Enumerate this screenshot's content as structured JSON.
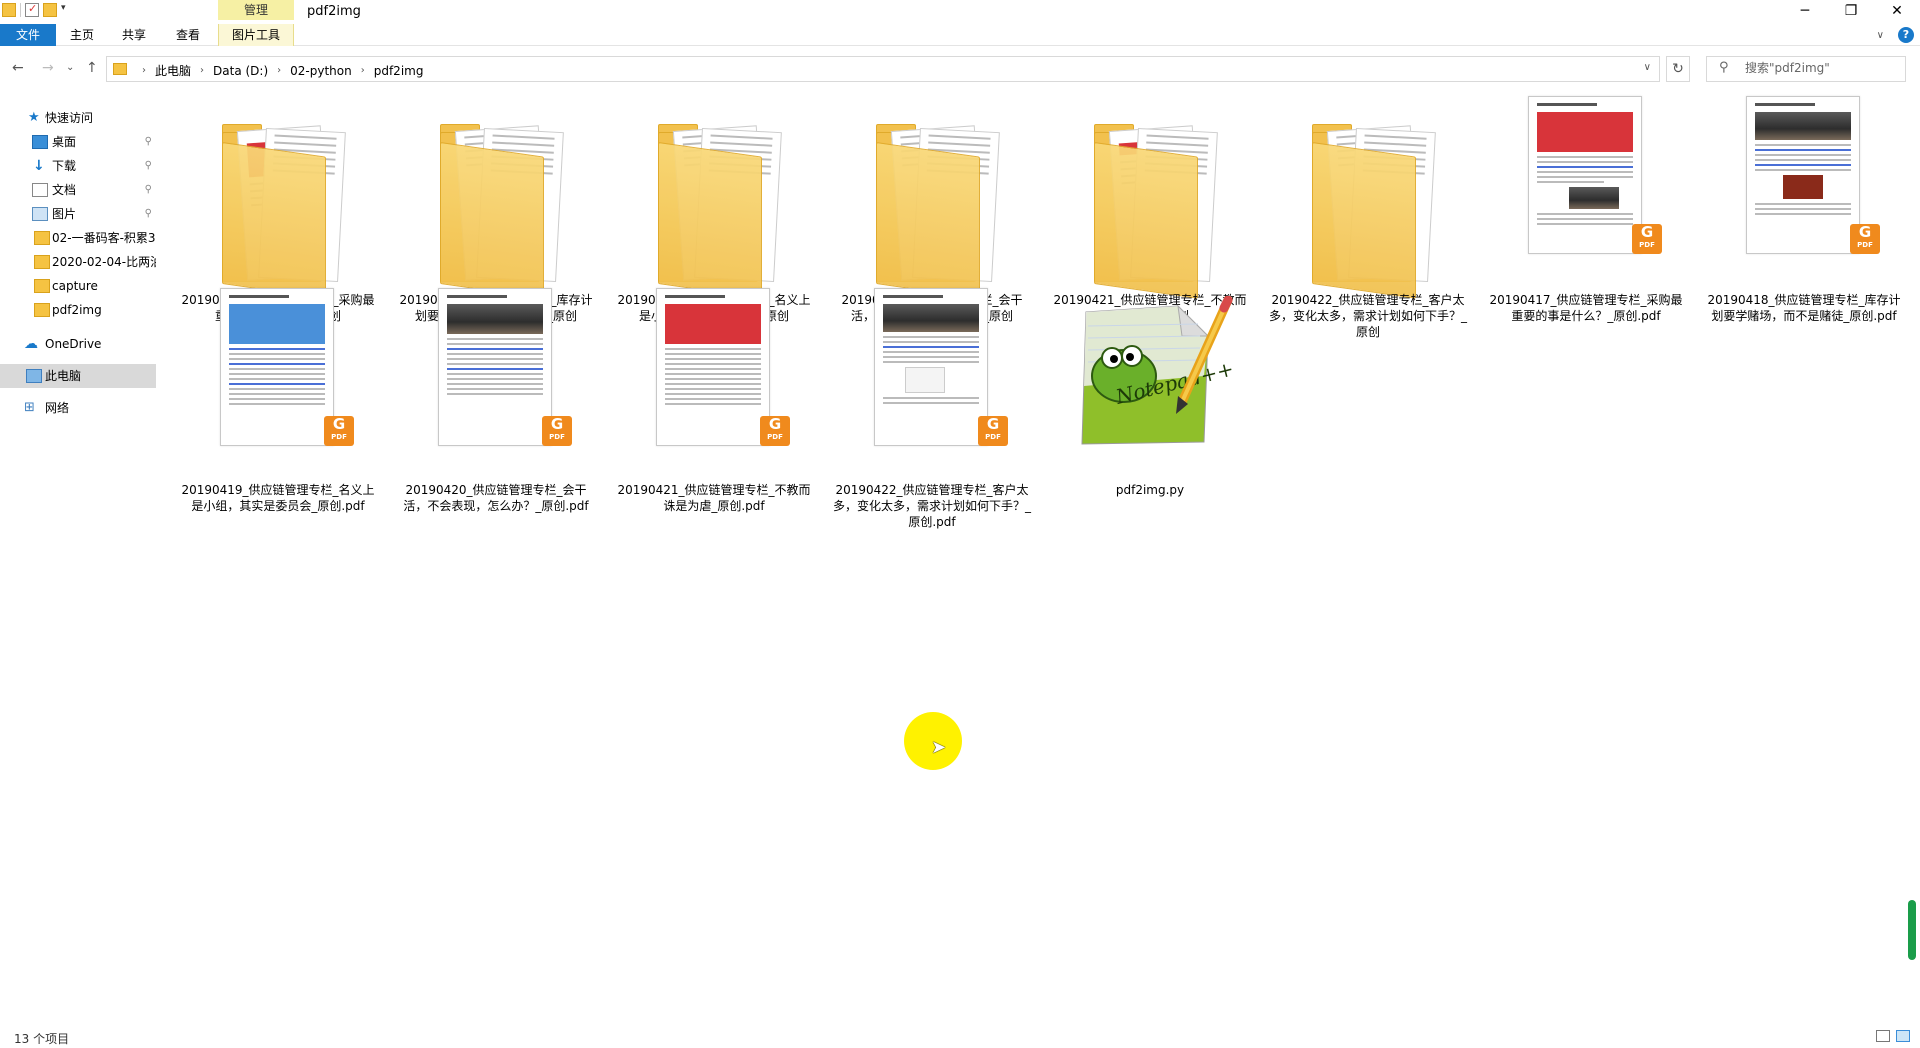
{
  "window": {
    "title": "pdf2img",
    "context_tab": "管理",
    "controls": {
      "minimize": "─",
      "maximize": "❐",
      "close": "✕"
    }
  },
  "ribbon": {
    "tabs": [
      {
        "label": "文件"
      },
      {
        "label": "主页"
      },
      {
        "label": "共享"
      },
      {
        "label": "查看"
      },
      {
        "label": "图片工具"
      }
    ],
    "expand_icon": "chevron-down-icon",
    "help_icon": "help-icon"
  },
  "nav": {
    "back": "←",
    "forward": "→",
    "recent": "⌄",
    "up": "↑",
    "breadcrumbs": [
      "此电脑",
      "Data (D:)",
      "02-python",
      "pdf2img"
    ],
    "refresh": "↻",
    "search_placeholder": "搜索\"pdf2img\""
  },
  "sidebar": {
    "items": [
      {
        "label": "快速访问",
        "icon": "star-icon",
        "pinned": false
      },
      {
        "label": "桌面",
        "icon": "desktop-icon",
        "pinned": true
      },
      {
        "label": "下载",
        "icon": "download-icon",
        "pinned": true
      },
      {
        "label": "文档",
        "icon": "documents-icon",
        "pinned": true
      },
      {
        "label": "图片",
        "icon": "pictures-icon",
        "pinned": true
      },
      {
        "label": "02-一番码客-积累3",
        "icon": "folder-icon",
        "pinned": false
      },
      {
        "label": "2020-02-04-比两油",
        "icon": "folder-icon",
        "pinned": false
      },
      {
        "label": "capture",
        "icon": "folder-icon",
        "pinned": false
      },
      {
        "label": "pdf2img",
        "icon": "folder-icon",
        "pinned": false
      },
      {
        "label": "OneDrive",
        "icon": "cloud-icon",
        "pinned": false
      },
      {
        "label": "此电脑",
        "icon": "computer-icon",
        "pinned": false,
        "selected": true
      },
      {
        "label": "网络",
        "icon": "network-icon",
        "pinned": false
      }
    ],
    "pin_glyph": "📌"
  },
  "files": [
    {
      "name": "20190417_供应链管理专栏_采购最重要的事是什么？_原创",
      "type": "folder",
      "accent": "red"
    },
    {
      "name": "20190418_供应链管理专栏_库存计划要学赌场，而不是赌徒_原创",
      "type": "folder",
      "accent": "none"
    },
    {
      "name": "20190419_供应链管理专栏_名义上是小组，其实是委员会_原创",
      "type": "folder",
      "accent": "none"
    },
    {
      "name": "20190420_供应链管理专栏_会干活，不会表现，怎么办？_原创",
      "type": "folder",
      "accent": "none"
    },
    {
      "name": "20190421_供应链管理专栏_不教而诛是为虐_原创",
      "type": "folder",
      "accent": "red"
    },
    {
      "name": "20190422_供应链管理专栏_客户太多，变化太多，需求计划如何下手？_原创",
      "type": "folder",
      "accent": "none"
    },
    {
      "name": "20190417_供应链管理专栏_采购最重要的事是什么？_原创.pdf",
      "type": "pdf",
      "cover": "red"
    },
    {
      "name": "20190418_供应链管理专栏_库存计划要学赌场，而不是赌徒_原创.pdf",
      "type": "pdf",
      "cover": "photo"
    },
    {
      "name": "20190419_供应链管理专栏_名义上是小组，其实是委员会_原创.pdf",
      "type": "pdf",
      "cover": "blue"
    },
    {
      "name": "20190420_供应链管理专栏_会干活，不会表现，怎么办？_原创.pdf",
      "type": "pdf",
      "cover": "photo"
    },
    {
      "name": "20190421_供应链管理专栏_不教而诛是为虐_原创.pdf",
      "type": "pdf",
      "cover": "red"
    },
    {
      "name": "20190422_供应链管理专栏_客户太多，变化太多，需求计划如何下手？_原创.pdf",
      "type": "pdf",
      "cover": "photo"
    },
    {
      "name": "pdf2img.py",
      "type": "py",
      "cover": "notepadpp"
    }
  ],
  "pdf_badge": {
    "glyph": "G",
    "text": "PDF"
  },
  "notepad_logo_text": "Notepad++",
  "status": {
    "item_count": "13 个项目"
  },
  "colors": {
    "accent": "#1979ca",
    "folder": "#f2c14e",
    "pdf_badge": "#f08a1d",
    "cursor_highlight": "#fff200"
  }
}
